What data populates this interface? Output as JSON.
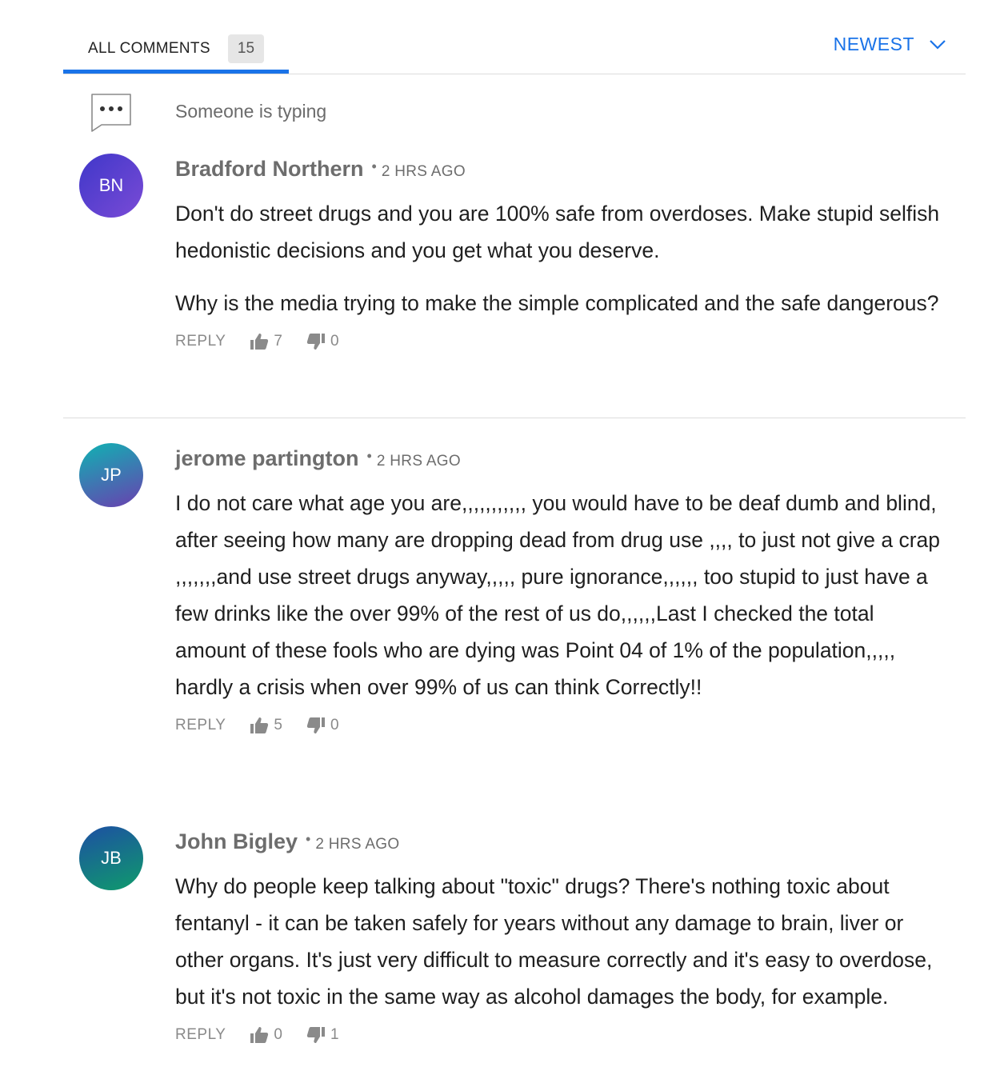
{
  "tabs": {
    "all_comments_label": "ALL COMMENTS",
    "count": "15"
  },
  "sort": {
    "label": "NEWEST",
    "icon": "chevron-down-icon"
  },
  "typing": {
    "text": "Someone is typing",
    "icon": "typing-bubble-icon"
  },
  "colors": {
    "accent": "#1a73e8",
    "muted": "#8a8a8a"
  },
  "comments": [
    {
      "initials": "BN",
      "author": "Bradford Northern",
      "time": "2 HRS AGO",
      "paragraphs": [
        "Don't do street drugs and you are 100% safe from overdoses. Make stupid selfish hedonistic decisions and you get what you deserve.",
        "Why is the media trying to make the simple complicated and the safe dangerous?"
      ],
      "reply_label": "REPLY",
      "upvotes": "7",
      "downvotes": "0",
      "avatar_colors": [
        "#3f37c9",
        "#7a4bd6"
      ]
    },
    {
      "initials": "JP",
      "author": "jerome partington",
      "time": "2 HRS AGO",
      "paragraphs": [
        "I do not care what age you are,,,,,,,,,,, you would have to be deaf dumb and blind, after seeing how many are dropping dead from drug use ,,,, to just not give a crap ,,,,,,,and use street drugs anyway,,,,, pure ignorance,,,,,, too stupid to just have a few drinks like the over 99% of the rest of us do,,,,,,Last I checked the total amount of these fools who are dying was Point 04 of 1% of the population,,,,, hardly a crisis when over 99% of us can think Correctly!!"
      ],
      "reply_label": "REPLY",
      "upvotes": "5",
      "downvotes": "0",
      "avatar_colors": [
        "#0fb3b3",
        "#6a3fb0"
      ]
    },
    {
      "initials": "JB",
      "author": "John Bigley",
      "time": "2 HRS AGO",
      "paragraphs": [
        "Why do people keep talking about \"toxic\" drugs? There's nothing toxic about fentanyl - it can be taken safely for years without any damage to brain, liver or other organs. It's just very difficult to measure correctly and it's easy to overdose, but it's not toxic in the same way as alcohol damages the body, for example."
      ],
      "reply_label": "REPLY",
      "upvotes": "0",
      "downvotes": "1",
      "avatar_colors": [
        "#1d4fa3",
        "#0f9b6c"
      ]
    }
  ]
}
